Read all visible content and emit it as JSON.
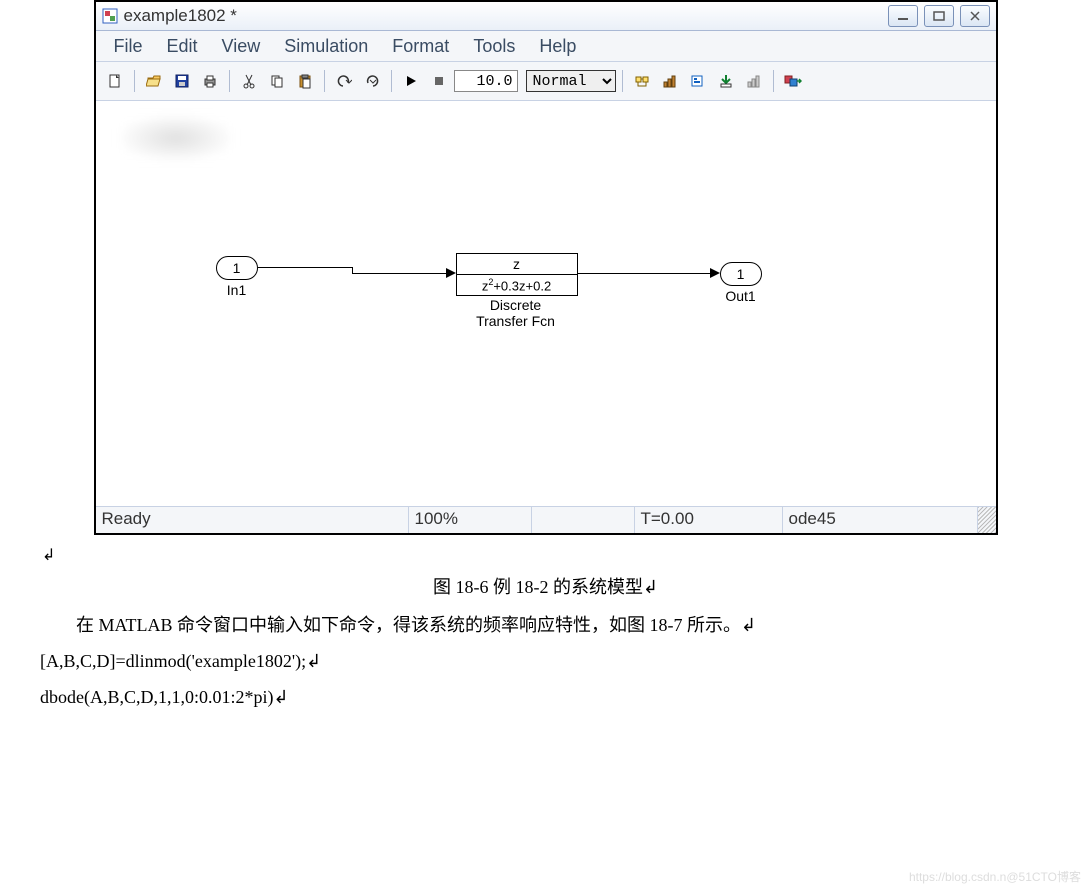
{
  "title": "example1802 *",
  "menus": [
    "File",
    "Edit",
    "View",
    "Simulation",
    "Format",
    "Tools",
    "Help"
  ],
  "simtime": "10.0",
  "simmode": "Normal",
  "status": {
    "ready": "Ready",
    "zoom": "100%",
    "mid": "",
    "time": "T=0.00",
    "solver": "ode45"
  },
  "diagram": {
    "in_port": "1",
    "in_lbl": "In1",
    "blk_num": "z",
    "blk_den": "z²+0.3z+0.2",
    "blk_lbl1": "Discrete",
    "blk_lbl2": "Transfer Fcn",
    "out_port": "1",
    "out_lbl": "Out1"
  },
  "caption": "图 18-6   例 18-2 的系统模型↲",
  "body1": "在 MATLAB 命令窗口中输入如下命令，得该系统的频率响应特性，如图 18-7 所示。↲",
  "code1": "[A,B,C,D]=dlinmod('example1802');↲",
  "code2": "dbode(A,B,C,D,1,1,0:0.01:2*pi)↲",
  "watermark": "https://blog.csdn.n@51CTO博客"
}
